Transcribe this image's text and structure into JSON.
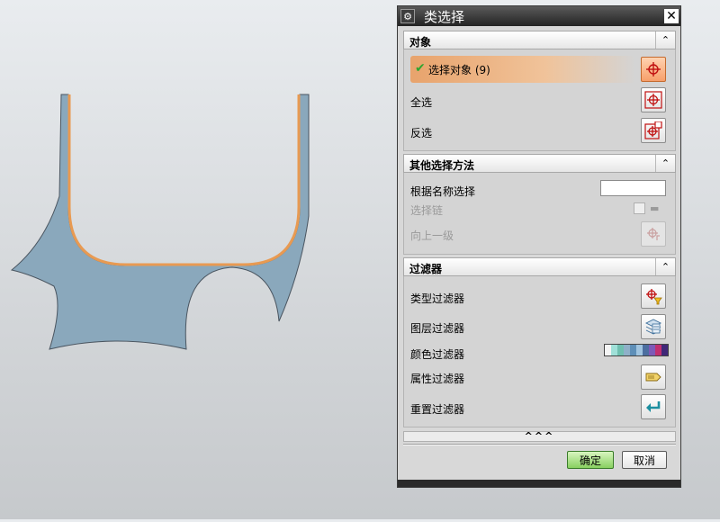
{
  "dialog": {
    "title": "类选择",
    "close_label": "✕",
    "gear_label": "⚙"
  },
  "groups": {
    "object": {
      "header": "对象",
      "selected_label": "选择对象 (9)",
      "select_all": "全选",
      "invert": "反选"
    },
    "other": {
      "header": "其他选择方法",
      "by_name": "根据名称选择",
      "name_value": "",
      "chain": "选择链",
      "up_level": "向上一级"
    },
    "filter": {
      "header": "过滤器",
      "type_filter": "类型过滤器",
      "layer_filter": "图层过滤器",
      "color_filter": "颜色过滤器",
      "attribute_filter": "属性过滤器",
      "reset_filter": "重置过滤器"
    }
  },
  "more_label": "^^^",
  "buttons": {
    "ok": "确定",
    "cancel": "取消"
  },
  "icons": {
    "collapse": "chevron-up-icon",
    "check": "checkmark-icon",
    "colors": [
      "#f4f4f4",
      "#9fe0d8",
      "#6fbfb0",
      "#8fb0c8",
      "#5e8fb8",
      "#a0c4e0",
      "#4c6ea0",
      "#7d5ab8",
      "#c03070",
      "#402878"
    ]
  },
  "viewport": {
    "part_fill": "#8aa8bc",
    "edge_highlight": "#e89a52"
  }
}
